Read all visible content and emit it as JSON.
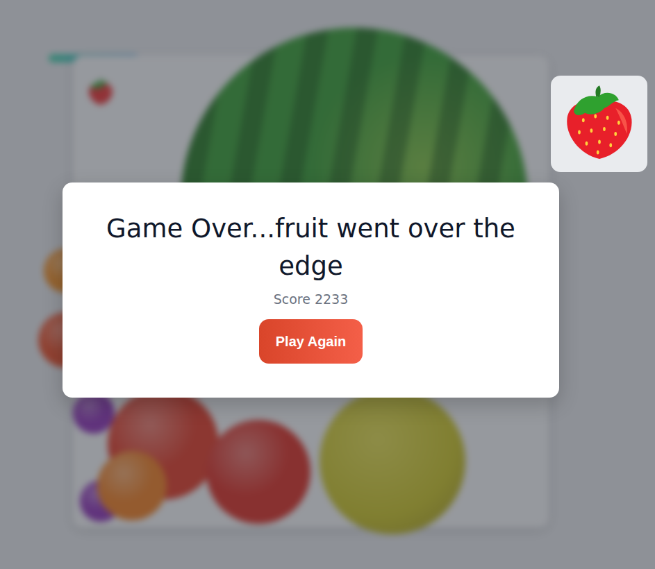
{
  "background": {
    "progress": {
      "level": 0.26
    },
    "held_fruit": {
      "kind": "strawberry"
    },
    "fruits": [
      {
        "kind": "watermelon",
        "color": "#2f9a2c"
      },
      {
        "kind": "orange",
        "color": "#f08a1c"
      },
      {
        "kind": "orange",
        "color": "#e8461f"
      },
      {
        "kind": "grape",
        "color": "#8a2bb5"
      },
      {
        "kind": "grape",
        "color": "#8a2bb5"
      },
      {
        "kind": "apple",
        "color": "#e0321e"
      },
      {
        "kind": "orange",
        "color": "#f07a1a"
      },
      {
        "kind": "tomato",
        "color": "#d9261c"
      },
      {
        "kind": "melon",
        "color": "#c9c21e"
      }
    ]
  },
  "dialog": {
    "title": "Game Over...fruit went over the edge",
    "score_label": "Score",
    "score_value": "2233",
    "button": "Play Again"
  },
  "next_fruit": {
    "kind": "strawberry"
  }
}
